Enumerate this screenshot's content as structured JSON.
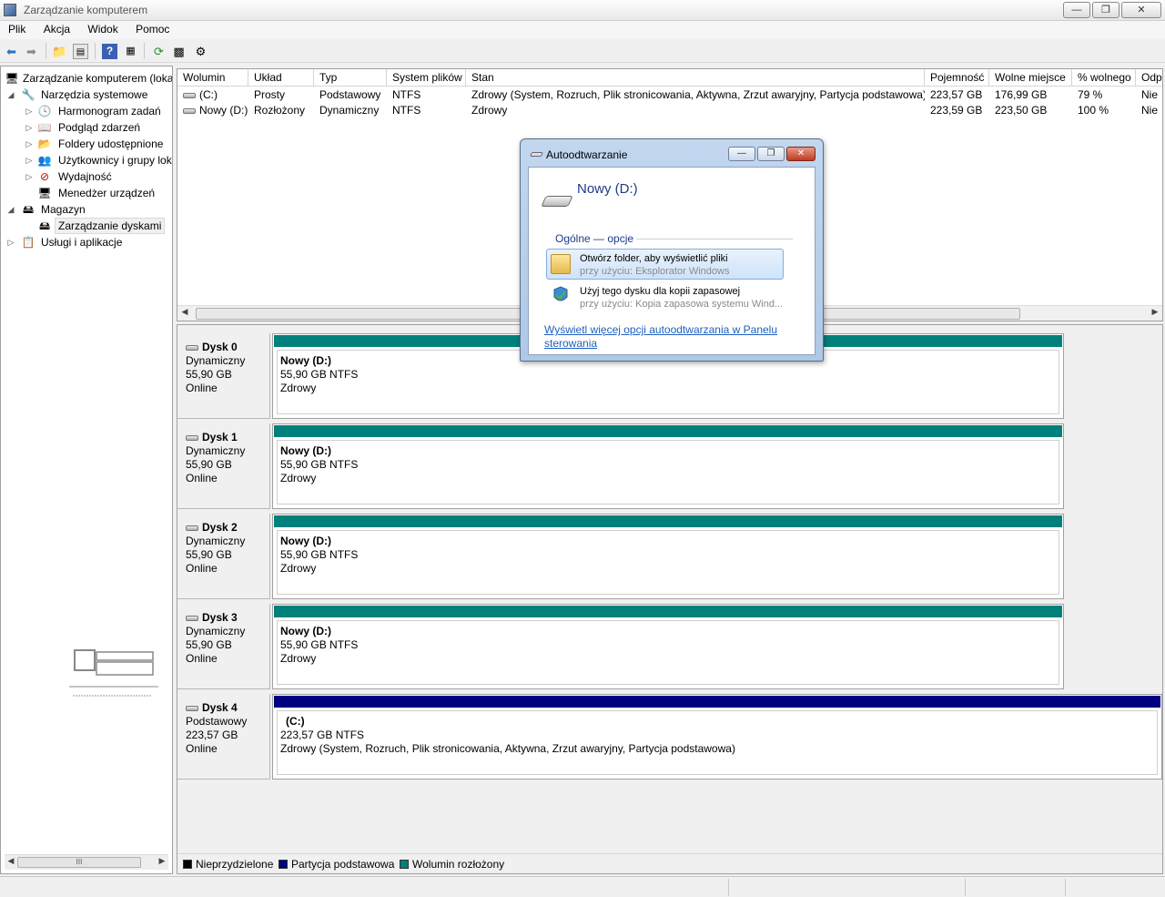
{
  "window": {
    "title": "Zarządzanie komputerem"
  },
  "menu": [
    "Plik",
    "Akcja",
    "Widok",
    "Pomoc"
  ],
  "tree": {
    "root": "Zarządzanie komputerem (loka",
    "tools": "Narzędzia systemowe",
    "items": [
      "Harmonogram zadań",
      "Podgląd zdarzeń",
      "Foldery udostępnione",
      "Użytkownicy i grupy lok",
      "Wydajność",
      "Menedżer urządzeń"
    ],
    "storage": "Magazyn",
    "disk_mgmt": "Zarządzanie dyskami",
    "services": "Usługi i aplikacje"
  },
  "volumes": {
    "columns": [
      "Wolumin",
      "Układ",
      "Typ",
      "System plików",
      "Stan",
      "Pojemność",
      "Wolne miejsce",
      "% wolnego",
      "Odp"
    ],
    "rows": [
      [
        "(C:)",
        "Prosty",
        "Podstawowy",
        "NTFS",
        "Zdrowy (System, Rozruch, Plik stronicowania, Aktywna, Zrzut awaryjny, Partycja podstawowa)",
        "223,57 GB",
        "176,99 GB",
        "79 %",
        "Nie"
      ],
      [
        "Nowy (D:)",
        "Rozłożony",
        "Dynamiczny",
        "NTFS",
        "Zdrowy",
        "223,59 GB",
        "223,50 GB",
        "100 %",
        "Nie"
      ]
    ]
  },
  "disks": [
    {
      "name": "Dysk 0",
      "type": "Dynamiczny",
      "size": "55,90 GB",
      "status": "Online",
      "part_name": "Nowy  (D:)",
      "part_size": "55,90 GB NTFS",
      "part_state": "Zdrowy",
      "color": "#00807a"
    },
    {
      "name": "Dysk 1",
      "type": "Dynamiczny",
      "size": "55,90 GB",
      "status": "Online",
      "part_name": "Nowy  (D:)",
      "part_size": "55,90 GB NTFS",
      "part_state": "Zdrowy",
      "color": "#00807a"
    },
    {
      "name": "Dysk 2",
      "type": "Dynamiczny",
      "size": "55,90 GB",
      "status": "Online",
      "part_name": "Nowy  (D:)",
      "part_size": "55,90 GB NTFS",
      "part_state": "Zdrowy",
      "color": "#00807a"
    },
    {
      "name": "Dysk 3",
      "type": "Dynamiczny",
      "size": "55,90 GB",
      "status": "Online",
      "part_name": "Nowy  (D:)",
      "part_size": "55,90 GB NTFS",
      "part_state": "Zdrowy",
      "color": "#00807a"
    },
    {
      "name": "Dysk 4",
      "type": "Podstawowy",
      "size": "223,57 GB",
      "status": "Online",
      "part_name": "(C:)",
      "part_size": "223,57 GB NTFS",
      "part_state": "Zdrowy (System, Rozruch, Plik stronicowania, Aktywna, Zrzut awaryjny, Partycja podstawowa)",
      "color": "#000080"
    }
  ],
  "legend": [
    {
      "label": "Nieprzydzielone",
      "color": "#000000"
    },
    {
      "label": "Partycja podstawowa",
      "color": "#000080"
    },
    {
      "label": "Wolumin rozłożony",
      "color": "#00807a"
    }
  ],
  "dialog": {
    "title": "Autoodtwarzanie",
    "heading": "Nowy (D:)",
    "group": "Ogólne — opcje",
    "options": [
      {
        "title": "Otwórz folder, aby wyświetlić pliki",
        "sub": "przy użyciu: Eksplorator Windows"
      },
      {
        "title": "Użyj tego dysku dla kopii zapasowej",
        "sub": "przy użyciu: Kopia zapasowa systemu Wind..."
      }
    ],
    "link": "Wyświetl więcej opcji autoodtwarzania w Panelu sterowania"
  },
  "scroll_thumb": "III"
}
